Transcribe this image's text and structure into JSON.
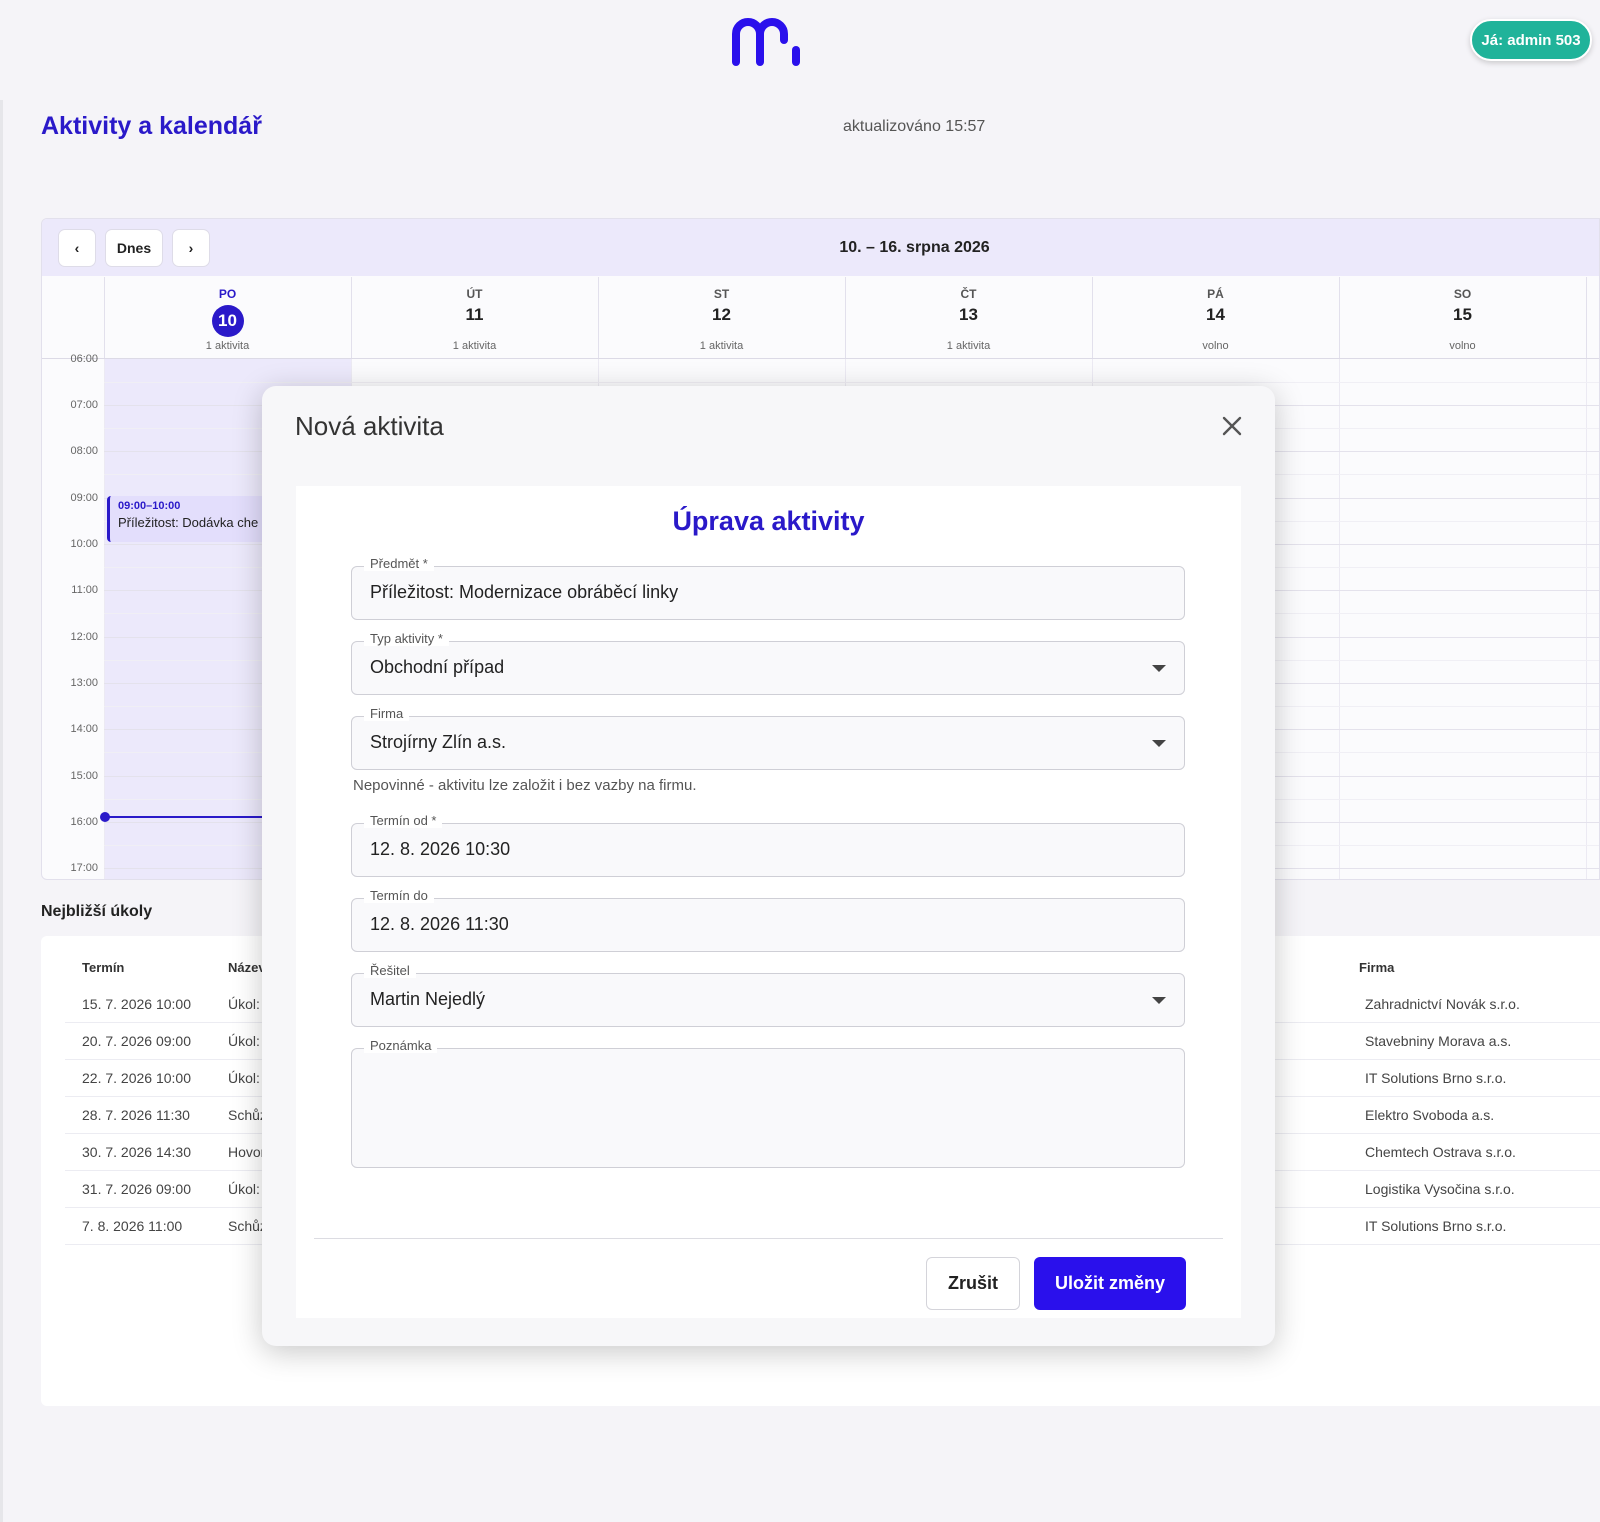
{
  "header": {
    "logo_icon": "m-logo-icon",
    "user_badge": "Já: admin 503",
    "brand_color": "#2a19c9",
    "badge_color": "#20b39a"
  },
  "page": {
    "title": "Aktivity a kalendář",
    "updated": "aktualizováno 15:57"
  },
  "calendar": {
    "prev_label": "‹",
    "today_label": "Dnes",
    "next_label": "›",
    "range": "10. – 16. srpna 2026",
    "days": [
      {
        "name": "PO",
        "num": "10",
        "sub": "1 aktivita",
        "today": true
      },
      {
        "name": "ÚT",
        "num": "11",
        "sub": "1 aktivita"
      },
      {
        "name": "ST",
        "num": "12",
        "sub": "1 aktivita"
      },
      {
        "name": "ČT",
        "num": "13",
        "sub": "1 aktivita"
      },
      {
        "name": "PÁ",
        "num": "14",
        "sub": "volno"
      },
      {
        "name": "SO",
        "num": "15",
        "sub": "volno"
      }
    ],
    "times": [
      "06:00",
      "07:00",
      "08:00",
      "09:00",
      "10:00",
      "11:00",
      "12:00",
      "13:00",
      "14:00",
      "15:00",
      "16:00",
      "17:00"
    ],
    "event": {
      "time": "09:00–10:00",
      "title": "Příležitost: Dodávka che"
    }
  },
  "tasks": {
    "title": "Nejbližší úkoly",
    "headers": {
      "termin": "Termín",
      "nazev": "Název",
      "firma": "Firma"
    },
    "rows": [
      {
        "termin": "15. 7. 2026 10:00",
        "nazev": "Úkol:",
        "firma": "Zahradnictví Novák s.r.o."
      },
      {
        "termin": "20. 7. 2026 09:00",
        "nazev": "Úkol:",
        "firma": "Stavebniny Morava a.s."
      },
      {
        "termin": "22. 7. 2026 10:00",
        "nazev": "Úkol:",
        "firma": "IT Solutions Brno s.r.o."
      },
      {
        "termin": "28. 7. 2026 11:30",
        "nazev": "Schůz",
        "firma": "Elektro Svoboda a.s."
      },
      {
        "termin": "30. 7. 2026 14:30",
        "nazev": "Hovor",
        "firma": "Chemtech Ostrava s.r.o."
      },
      {
        "termin": "31. 7. 2026 09:00",
        "nazev": "Úkol:",
        "firma": "Logistika Vysočina s.r.o."
      },
      {
        "termin": "7. 8. 2026 11:00",
        "nazev": "Schůz",
        "firma": "IT Solutions Brno s.r.o."
      }
    ]
  },
  "dialog": {
    "title": "Nová aktivita",
    "close_icon": "close-icon",
    "form_title": "Úprava aktivity",
    "fields": {
      "predmet": {
        "label": "Předmět *",
        "value": "Příležitost: Modernizace obráběcí linky"
      },
      "typ": {
        "label": "Typ aktivity *",
        "value": "Obchodní případ"
      },
      "firma": {
        "label": "Firma",
        "value": "Strojírny Zlín a.s."
      },
      "firma_hint": "Nepovinné - aktivitu lze založit i bez vazby na firmu.",
      "od": {
        "label": "Termín od *",
        "value": "12. 8. 2026 10:30"
      },
      "do": {
        "label": "Termín do",
        "value": "12. 8. 2026 11:30"
      },
      "resitel": {
        "label": "Řešitel",
        "value": "Martin Nejedlý"
      },
      "poznamka": {
        "label": "Poznámka",
        "value": ""
      }
    },
    "cancel_label": "Zrušit",
    "save_label": "Uložit změny",
    "save_color": "#2a10ec"
  }
}
